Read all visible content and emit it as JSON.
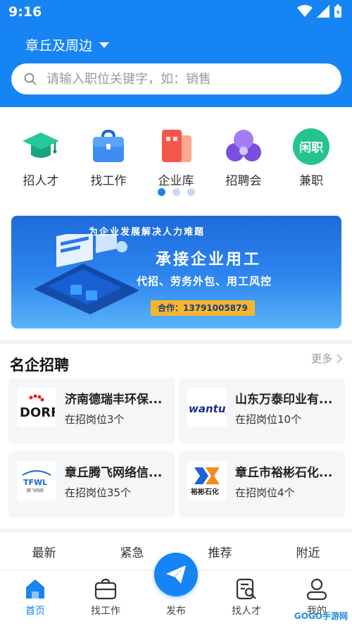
{
  "status_bar": {
    "time": "9:16"
  },
  "header": {
    "location": "章丘及周边",
    "search_placeholder": "请输入职位关键字，如：销售"
  },
  "categories": [
    {
      "label": "招人才",
      "icon": "graduation-cap-icon"
    },
    {
      "label": "找工作",
      "icon": "briefcase-icon"
    },
    {
      "label": "企业库",
      "icon": "company-library-icon"
    },
    {
      "label": "招聘会",
      "icon": "job-fair-icon"
    },
    {
      "label": "兼职",
      "icon": "part-time-icon",
      "badge_text": "闲职"
    }
  ],
  "carousel": {
    "pages": 3,
    "active": 1
  },
  "banner": {
    "top_text": "为企业发展解决人力难题",
    "title": "承接企业用工",
    "subtitle": "代招、劳务外包、用工风控",
    "contact": "合作：13791005879"
  },
  "featured": {
    "title": "名企招聘",
    "more_label": "更多",
    "companies": [
      {
        "name": "济南德瑞丰环保...",
        "count": "在招岗位3个",
        "logo_text": "DORF"
      },
      {
        "name": "山东万泰印业有...",
        "count": "在招岗位10个",
        "logo_text": "wantup"
      },
      {
        "name": "章丘腾飞网络信...",
        "count": "在招岗位35个",
        "logo_text": "TFWL",
        "logo_caption": "腾飞网络"
      },
      {
        "name": "章丘市裕彬石化...",
        "count": "在招岗位4个",
        "logo_text": "裕彬石化"
      }
    ]
  },
  "tabs": [
    "最新",
    "紧急",
    "推荐",
    "附近"
  ],
  "bottom_nav": [
    {
      "label": "首页",
      "icon": "home-icon",
      "active": true
    },
    {
      "label": "找工作",
      "icon": "briefcase-icon"
    },
    {
      "label": "发布",
      "icon": "paper-plane-icon"
    },
    {
      "label": "找人才",
      "icon": "find-talent-icon"
    },
    {
      "label": "我的",
      "icon": "profile-icon"
    }
  ],
  "watermark": "GOGO手游网",
  "colors": {
    "primary": "#1784f4",
    "background": "#f4f5f7"
  }
}
